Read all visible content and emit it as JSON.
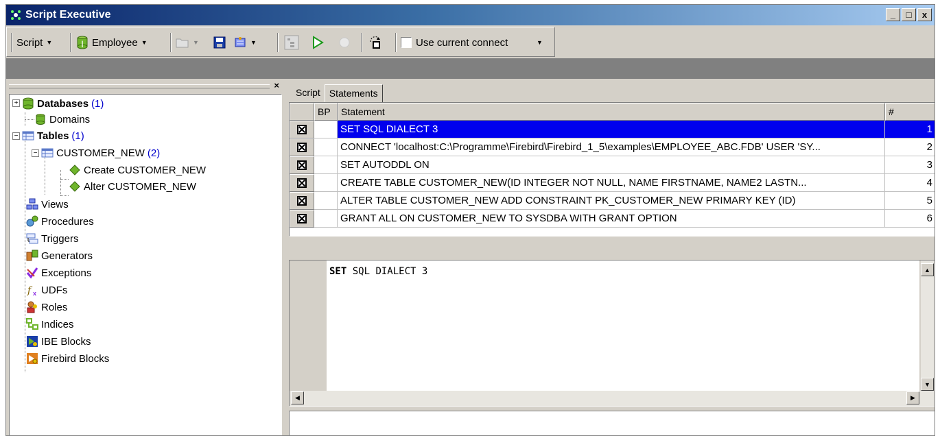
{
  "window": {
    "title": "Script Executive",
    "min_label": "_",
    "max_label": "□",
    "close_label": "x"
  },
  "toolbar": {
    "script_label": "Script",
    "database_label": "Employee",
    "use_current_connect_label": "Use current connect"
  },
  "tree": {
    "close_label": "×",
    "databases": {
      "label": "Databases",
      "count": "(1)"
    },
    "domains": {
      "label": "Domains"
    },
    "tables": {
      "label": "Tables",
      "count": "(1)"
    },
    "customer_new": {
      "label": "CUSTOMER_NEW",
      "count": "(2)"
    },
    "create_customer_new": {
      "label": "Create CUSTOMER_NEW"
    },
    "alter_customer_new": {
      "label": "Alter CUSTOMER_NEW"
    },
    "views": {
      "label": "Views"
    },
    "procedures": {
      "label": "Procedures"
    },
    "triggers": {
      "label": "Triggers"
    },
    "generators": {
      "label": "Generators"
    },
    "exceptions": {
      "label": "Exceptions"
    },
    "udfs": {
      "label": "UDFs"
    },
    "roles": {
      "label": "Roles"
    },
    "indices": {
      "label": "Indices"
    },
    "ibe_blocks": {
      "label": "IBE Blocks"
    },
    "firebird_blocks": {
      "label": "Firebird Blocks"
    }
  },
  "tabs": [
    {
      "label": "Script"
    },
    {
      "label": "Statements"
    }
  ],
  "grid": {
    "headers": {
      "bp": "BP",
      "statement": "Statement",
      "num": "#"
    },
    "rows": [
      {
        "statement": "SET SQL DIALECT 3",
        "num": "1"
      },
      {
        "statement": "CONNECT 'localhost:C:\\Programme\\Firebird\\Firebird_1_5\\examples\\EMPLOYEE_ABC.FDB' USER 'SY...",
        "num": "2"
      },
      {
        "statement": "SET AUTODDL ON",
        "num": "3"
      },
      {
        "statement": "CREATE TABLE CUSTOMER_NEW(ID INTEGER NOT NULL,  NAME FIRSTNAME,  NAME2 LASTN...",
        "num": "4"
      },
      {
        "statement": "ALTER TABLE CUSTOMER_NEW ADD CONSTRAINT PK_CUSTOMER_NEW PRIMARY KEY (ID)",
        "num": "5"
      },
      {
        "statement": "GRANT ALL ON CUSTOMER_NEW TO SYSDBA WITH GRANT OPTION",
        "num": "6"
      }
    ],
    "selected_row": 0
  },
  "editor": {
    "keyword": "SET",
    "rest": " SQL DIALECT 3"
  },
  "colors": {
    "selection": "#0000ee",
    "count": "#0000cc",
    "title_gradient_start": "#0a246a"
  },
  "icons": {
    "db": "database-icon",
    "table": "table-icon",
    "diamond": "green-diamond-icon"
  }
}
